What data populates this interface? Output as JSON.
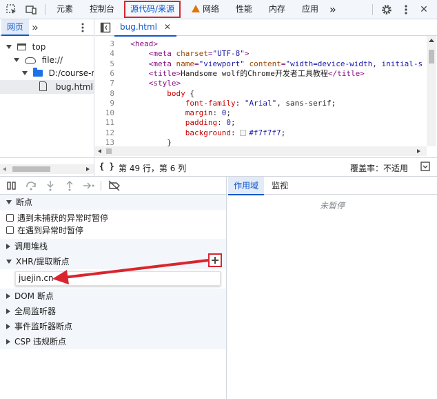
{
  "toolbar": {
    "tabs": [
      "元素",
      "控制台",
      "源代码/来源",
      "网络",
      "性能",
      "内存",
      "应用"
    ],
    "more": "»",
    "settings_icon": "gear-icon",
    "menu_icon": "kebab-icon",
    "close": "✕"
  },
  "navigator": {
    "tab": "网页",
    "more": "»",
    "tree": [
      "top",
      "file://",
      "D:/course-rec",
      "bug.html"
    ]
  },
  "editor": {
    "file_tab": "bug.html",
    "close": "✕",
    "lines": [
      {
        "n": "3",
        "parts": [
          [
            "tg",
            "  <head>"
          ]
        ]
      },
      {
        "n": "4",
        "parts": [
          [
            "tg",
            "      <meta "
          ],
          [
            "at",
            "charset"
          ],
          [
            "tg",
            "="
          ],
          [
            "av",
            "\"UTF-8\""
          ],
          [
            "tg",
            ">"
          ]
        ]
      },
      {
        "n": "5",
        "parts": [
          [
            "tg",
            "      <meta "
          ],
          [
            "at",
            "name"
          ],
          [
            "tg",
            "="
          ],
          [
            "av",
            "\"viewport\""
          ],
          [
            "tx",
            " "
          ],
          [
            "at",
            "content"
          ],
          [
            "tg",
            "="
          ],
          [
            "av",
            "\"width=device-width, initial-s"
          ]
        ]
      },
      {
        "n": "6",
        "parts": [
          [
            "tg",
            "      <title>"
          ],
          [
            "tx",
            "Handsome wolf的Chrome开发者工具教程"
          ],
          [
            "tg",
            "</title>"
          ]
        ]
      },
      {
        "n": "7",
        "parts": [
          [
            "tg",
            "      <style>"
          ]
        ]
      },
      {
        "n": "8",
        "parts": [
          [
            "kw",
            "          body"
          ],
          [
            "tx",
            " {"
          ]
        ]
      },
      {
        "n": "9",
        "parts": [
          [
            "kw",
            "              font-family"
          ],
          [
            "tx",
            ": "
          ],
          [
            "av",
            "\"Arial\""
          ],
          [
            "tx",
            ", sans-serif;"
          ]
        ]
      },
      {
        "n": "10",
        "parts": [
          [
            "kw",
            "              margin"
          ],
          [
            "tx",
            ": "
          ],
          [
            "av",
            "0"
          ],
          [
            "tx",
            ";"
          ]
        ]
      },
      {
        "n": "11",
        "parts": [
          [
            "kw",
            "              padding"
          ],
          [
            "tx",
            ": "
          ],
          [
            "av",
            "0"
          ],
          [
            "tx",
            ";"
          ]
        ]
      },
      {
        "n": "12",
        "parts": [
          [
            "kw",
            "              background"
          ],
          [
            "tx",
            ": "
          ],
          [
            "sw",
            ""
          ],
          [
            "av",
            "#f7f7f7"
          ],
          [
            "tx",
            ";"
          ]
        ]
      },
      {
        "n": "13",
        "parts": [
          [
            "tx",
            "          }"
          ]
        ]
      }
    ]
  },
  "status": {
    "braces": "{ }",
    "position": "第 49 行，第 6 列",
    "coverage": "覆盖率：不适用"
  },
  "debugger": {
    "sections": {
      "breakpoints": "断点",
      "pause_uncaught": "遇到未捕获的异常时暂停",
      "pause_caught": "在遇到异常时暂停",
      "call_stack": "调用堆栈",
      "xhr": "XHR/提取断点",
      "dom": "DOM 断点",
      "global": "全局监听器",
      "event": "事件监听器断点",
      "csp": "CSP 违规断点"
    },
    "xhr_input_value": "juejin.cn"
  },
  "scope": {
    "tabs": [
      "作用域",
      "监视"
    ],
    "not_paused": "未暂停"
  },
  "colors": {
    "accent": "#0b57d0",
    "annotation_red": "#d9262e"
  }
}
